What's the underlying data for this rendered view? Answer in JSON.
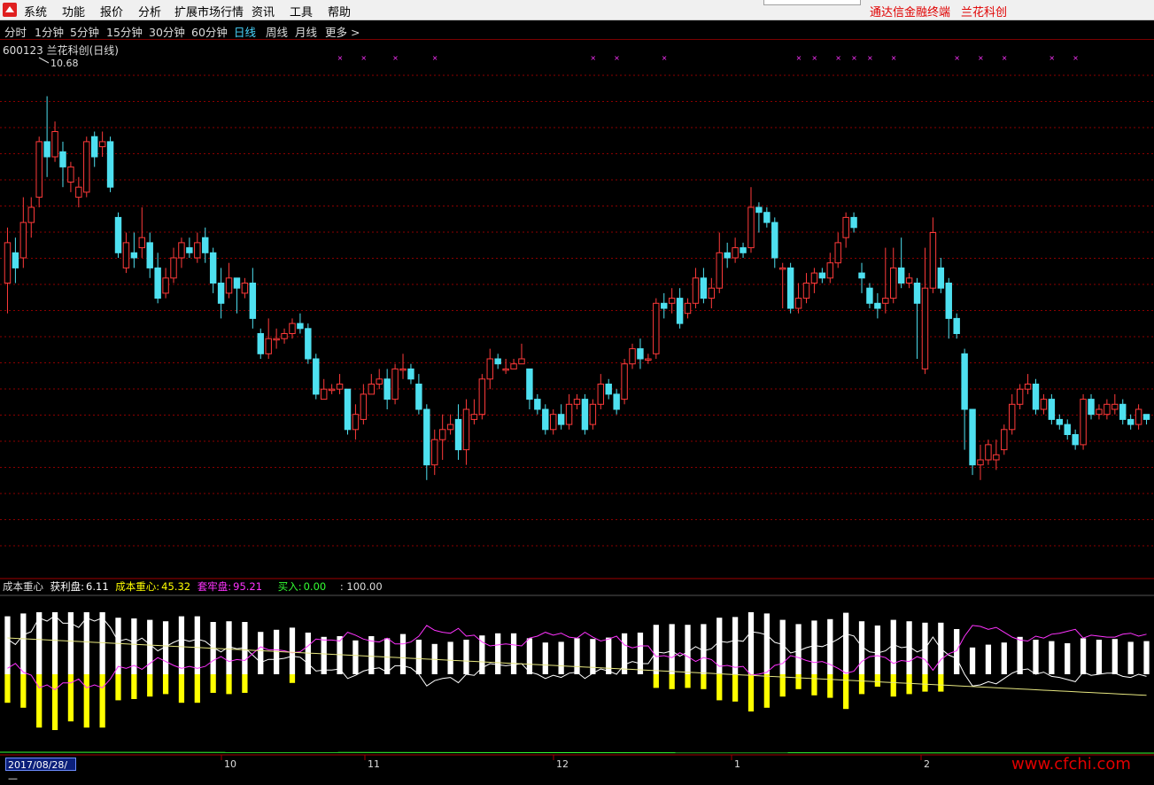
{
  "menu": {
    "items": [
      "系统",
      "功能",
      "报价",
      "分析",
      "扩展市场行情",
      "资讯",
      "工具",
      "帮助"
    ]
  },
  "brand": {
    "terminal": "通达信金融终端",
    "name": "兰花科创"
  },
  "periods": {
    "items": [
      "分时",
      "1分钟",
      "5分钟",
      "15分钟",
      "30分钟",
      "60分钟",
      "日线",
      "周线",
      "月线",
      "更多 >"
    ],
    "active": "日线"
  },
  "main_chart": {
    "title": "600123 兰花科创(日线)",
    "high_label": "10.68"
  },
  "indicator": {
    "name": "成本重心",
    "profit_label": "获利盘:",
    "profit_value": "6.11",
    "center_label": "成本重心:",
    "center_value": "45.32",
    "trapped_label": "套牢盘:",
    "trapped_value": "95.21",
    "buy_label": "买入:",
    "buy_value": "0.00",
    "extra_value": ": 100.00"
  },
  "axis": {
    "date_start": "2017/08/28/—",
    "month_labels": [
      "10",
      "11",
      "12",
      "1",
      "2"
    ]
  },
  "watermark": "www.cfchi.com",
  "colors": {
    "up": "#ff3a3a",
    "down": "#4ee0f0",
    "grid": "#8b0000",
    "profit_bar": "#ffff00",
    "trapped_line": "#ff33ff",
    "center_line": "#e6e680",
    "white_line": "#ffffff",
    "buy_line": "#33ff33"
  },
  "chart_data": {
    "type": "candlestick",
    "title": "600123 兰花科创(日线)",
    "visible_high": 10.68,
    "candles": [
      [
        0.55,
        0.63,
        0.49,
        0.66
      ],
      [
        0.61,
        0.58,
        0.55,
        0.64
      ],
      [
        0.6,
        0.67,
        0.58,
        0.72
      ],
      [
        0.67,
        0.7,
        0.64,
        0.72
      ],
      [
        0.72,
        0.83,
        0.7,
        0.84
      ],
      [
        0.83,
        0.8,
        0.76,
        0.92
      ],
      [
        0.8,
        0.85,
        0.79,
        0.87
      ],
      [
        0.81,
        0.78,
        0.74,
        0.83
      ],
      [
        0.75,
        0.78,
        0.73,
        0.79
      ],
      [
        0.72,
        0.74,
        0.7,
        0.76
      ],
      [
        0.73,
        0.83,
        0.72,
        0.84
      ],
      [
        0.84,
        0.8,
        0.78,
        0.85
      ],
      [
        0.82,
        0.83,
        0.8,
        0.85
      ],
      [
        0.83,
        0.74,
        0.73,
        0.84
      ],
      [
        0.68,
        0.61,
        0.6,
        0.69
      ],
      [
        0.58,
        0.63,
        0.57,
        0.65
      ],
      [
        0.61,
        0.6,
        0.58,
        0.65
      ],
      [
        0.62,
        0.64,
        0.6,
        0.7
      ],
      [
        0.63,
        0.58,
        0.56,
        0.65
      ],
      [
        0.58,
        0.52,
        0.51,
        0.61
      ],
      [
        0.53,
        0.56,
        0.52,
        0.58
      ],
      [
        0.56,
        0.6,
        0.55,
        0.62
      ],
      [
        0.6,
        0.63,
        0.58,
        0.64
      ],
      [
        0.62,
        0.61,
        0.6,
        0.64
      ],
      [
        0.6,
        0.63,
        0.59,
        0.65
      ],
      [
        0.64,
        0.61,
        0.59,
        0.66
      ],
      [
        0.61,
        0.55,
        0.53,
        0.62
      ],
      [
        0.55,
        0.51,
        0.48,
        0.58
      ],
      [
        0.53,
        0.56,
        0.52,
        0.59
      ],
      [
        0.56,
        0.54,
        0.49,
        0.56
      ],
      [
        0.53,
        0.55,
        0.52,
        0.56
      ],
      [
        0.55,
        0.48,
        0.46,
        0.58
      ],
      [
        0.45,
        0.41,
        0.4,
        0.46
      ],
      [
        0.41,
        0.44,
        0.4,
        0.48
      ],
      [
        0.44,
        0.44,
        0.42,
        0.46
      ],
      [
        0.44,
        0.45,
        0.43,
        0.46
      ],
      [
        0.45,
        0.47,
        0.44,
        0.48
      ],
      [
        0.47,
        0.46,
        0.45,
        0.49
      ],
      [
        0.46,
        0.4,
        0.39,
        0.47
      ],
      [
        0.4,
        0.33,
        0.32,
        0.41
      ],
      [
        0.32,
        0.34,
        0.32,
        0.36
      ],
      [
        0.34,
        0.34,
        0.33,
        0.35
      ],
      [
        0.34,
        0.35,
        0.33,
        0.37
      ],
      [
        0.34,
        0.26,
        0.25,
        0.34
      ],
      [
        0.26,
        0.29,
        0.24,
        0.31
      ],
      [
        0.28,
        0.33,
        0.27,
        0.35
      ],
      [
        0.33,
        0.35,
        0.33,
        0.37
      ],
      [
        0.35,
        0.36,
        0.34,
        0.38
      ],
      [
        0.36,
        0.32,
        0.3,
        0.38
      ],
      [
        0.32,
        0.38,
        0.31,
        0.39
      ],
      [
        0.38,
        0.38,
        0.36,
        0.41
      ],
      [
        0.38,
        0.36,
        0.35,
        0.39
      ],
      [
        0.35,
        0.3,
        0.29,
        0.37
      ],
      [
        0.3,
        0.19,
        0.16,
        0.31
      ],
      [
        0.19,
        0.24,
        0.17,
        0.26
      ],
      [
        0.24,
        0.26,
        0.2,
        0.29
      ],
      [
        0.26,
        0.27,
        0.25,
        0.29
      ],
      [
        0.28,
        0.22,
        0.2,
        0.31
      ],
      [
        0.22,
        0.3,
        0.19,
        0.32
      ],
      [
        0.28,
        0.29,
        0.27,
        0.32
      ],
      [
        0.29,
        0.36,
        0.28,
        0.37
      ],
      [
        0.36,
        0.4,
        0.34,
        0.42
      ],
      [
        0.4,
        0.39,
        0.38,
        0.41
      ],
      [
        0.38,
        0.38,
        0.37,
        0.4
      ],
      [
        0.38,
        0.39,
        0.38,
        0.4
      ],
      [
        0.39,
        0.4,
        0.39,
        0.43
      ],
      [
        0.38,
        0.32,
        0.3,
        0.38
      ],
      [
        0.32,
        0.3,
        0.29,
        0.33
      ],
      [
        0.3,
        0.26,
        0.25,
        0.31
      ],
      [
        0.26,
        0.29,
        0.25,
        0.3
      ],
      [
        0.29,
        0.27,
        0.26,
        0.31
      ],
      [
        0.27,
        0.31,
        0.26,
        0.33
      ],
      [
        0.31,
        0.32,
        0.3,
        0.33
      ],
      [
        0.32,
        0.26,
        0.25,
        0.33
      ],
      [
        0.27,
        0.31,
        0.26,
        0.32
      ],
      [
        0.31,
        0.35,
        0.3,
        0.37
      ],
      [
        0.35,
        0.33,
        0.32,
        0.36
      ],
      [
        0.33,
        0.3,
        0.29,
        0.34
      ],
      [
        0.32,
        0.39,
        0.31,
        0.4
      ],
      [
        0.39,
        0.42,
        0.38,
        0.43
      ],
      [
        0.42,
        0.4,
        0.38,
        0.44
      ],
      [
        0.4,
        0.4,
        0.39,
        0.41
      ],
      [
        0.41,
        0.51,
        0.4,
        0.52
      ],
      [
        0.51,
        0.5,
        0.48,
        0.53
      ],
      [
        0.51,
        0.52,
        0.49,
        0.54
      ],
      [
        0.52,
        0.47,
        0.46,
        0.54
      ],
      [
        0.49,
        0.51,
        0.48,
        0.52
      ],
      [
        0.51,
        0.56,
        0.5,
        0.58
      ],
      [
        0.56,
        0.52,
        0.51,
        0.58
      ],
      [
        0.52,
        0.54,
        0.5,
        0.56
      ],
      [
        0.54,
        0.61,
        0.53,
        0.65
      ],
      [
        0.61,
        0.6,
        0.58,
        0.63
      ],
      [
        0.6,
        0.62,
        0.59,
        0.64
      ],
      [
        0.62,
        0.61,
        0.6,
        0.63
      ],
      [
        0.62,
        0.7,
        0.61,
        0.74
      ],
      [
        0.7,
        0.69,
        0.65,
        0.71
      ],
      [
        0.69,
        0.67,
        0.66,
        0.7
      ],
      [
        0.67,
        0.6,
        0.58,
        0.68
      ],
      [
        0.58,
        0.58,
        0.5,
        0.59
      ],
      [
        0.58,
        0.5,
        0.49,
        0.59
      ],
      [
        0.5,
        0.52,
        0.49,
        0.55
      ],
      [
        0.52,
        0.55,
        0.51,
        0.57
      ],
      [
        0.55,
        0.57,
        0.53,
        0.58
      ],
      [
        0.57,
        0.56,
        0.55,
        0.58
      ],
      [
        0.56,
        0.59,
        0.55,
        0.61
      ],
      [
        0.59,
        0.63,
        0.58,
        0.65
      ],
      [
        0.64,
        0.68,
        0.62,
        0.69
      ],
      [
        0.68,
        0.66,
        0.65,
        0.69
      ],
      [
        0.57,
        0.56,
        0.53,
        0.59
      ],
      [
        0.54,
        0.51,
        0.5,
        0.55
      ],
      [
        0.51,
        0.5,
        0.48,
        0.53
      ],
      [
        0.51,
        0.52,
        0.49,
        0.62
      ],
      [
        0.52,
        0.58,
        0.51,
        0.62
      ],
      [
        0.58,
        0.55,
        0.54,
        0.64
      ],
      [
        0.55,
        0.56,
        0.54,
        0.57
      ],
      [
        0.55,
        0.51,
        0.4,
        0.56
      ],
      [
        0.38,
        0.54,
        0.37,
        0.62
      ],
      [
        0.54,
        0.65,
        0.53,
        0.68
      ],
      [
        0.58,
        0.54,
        0.53,
        0.6
      ],
      [
        0.55,
        0.48,
        0.44,
        0.56
      ],
      [
        0.48,
        0.45,
        0.44,
        0.49
      ],
      [
        0.41,
        0.3,
        0.22,
        0.42
      ],
      [
        0.3,
        0.19,
        0.17,
        0.3
      ],
      [
        0.19,
        0.2,
        0.16,
        0.23
      ],
      [
        0.2,
        0.23,
        0.19,
        0.24
      ],
      [
        0.2,
        0.21,
        0.18,
        0.24
      ],
      [
        0.22,
        0.26,
        0.21,
        0.27
      ],
      [
        0.26,
        0.31,
        0.25,
        0.33
      ],
      [
        0.31,
        0.34,
        0.3,
        0.35
      ],
      [
        0.34,
        0.35,
        0.33,
        0.37
      ],
      [
        0.35,
        0.3,
        0.29,
        0.36
      ],
      [
        0.3,
        0.32,
        0.29,
        0.33
      ],
      [
        0.32,
        0.28,
        0.27,
        0.33
      ],
      [
        0.28,
        0.27,
        0.26,
        0.29
      ],
      [
        0.27,
        0.25,
        0.24,
        0.28
      ],
      [
        0.25,
        0.23,
        0.22,
        0.26
      ],
      [
        0.23,
        0.32,
        0.22,
        0.33
      ],
      [
        0.32,
        0.29,
        0.28,
        0.33
      ],
      [
        0.29,
        0.3,
        0.28,
        0.31
      ],
      [
        0.29,
        0.31,
        0.28,
        0.32
      ],
      [
        0.3,
        0.31,
        0.29,
        0.33
      ],
      [
        0.31,
        0.28,
        0.27,
        0.32
      ],
      [
        0.28,
        0.27,
        0.26,
        0.29
      ],
      [
        0.27,
        0.3,
        0.26,
        0.31
      ],
      [
        0.29,
        0.28,
        0.27,
        0.29
      ]
    ],
    "month_labels": [
      "10",
      "11",
      "12",
      "1",
      "2"
    ]
  }
}
